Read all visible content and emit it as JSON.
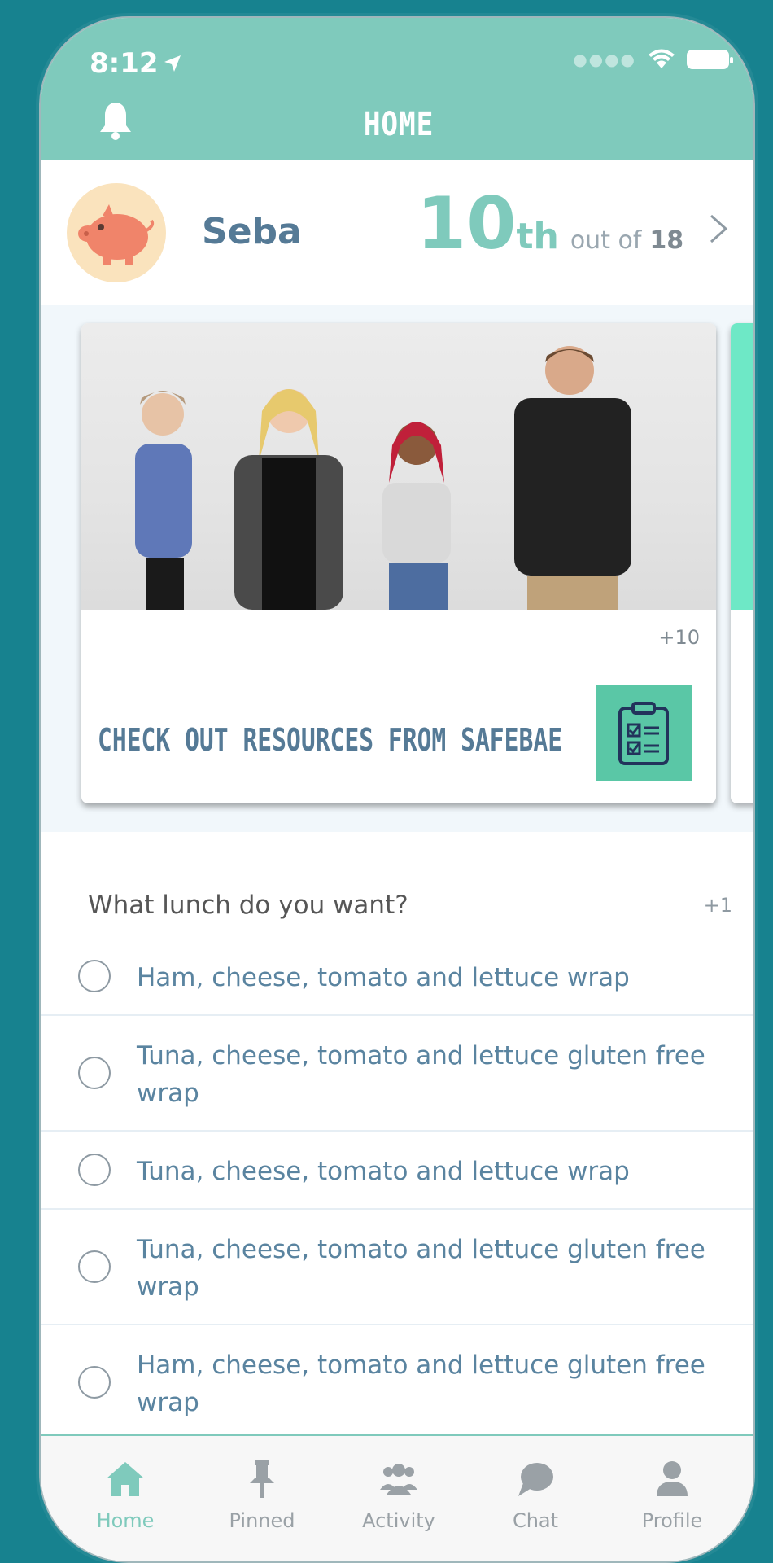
{
  "status_bar": {
    "time": "8:12"
  },
  "header": {
    "title": "HOME"
  },
  "profile": {
    "name": "Seba",
    "rank_number": "10",
    "rank_suffix": "th",
    "out_of_label": "out of",
    "total": "18"
  },
  "carousel": {
    "cards": [
      {
        "points": "+10",
        "title": "CHECK OUT RESOURCES FROM SAFEBAE"
      }
    ]
  },
  "poll": {
    "question": "What lunch do you want?",
    "points": "+1",
    "options": [
      "Ham, cheese, tomato and lettuce wrap",
      "Tuna, cheese, tomato and lettuce gluten free wrap",
      "Tuna, cheese, tomato and lettuce wrap",
      "Tuna, cheese, tomato and lettuce gluten free wrap",
      "Ham, cheese, tomato and lettuce gluten free wrap"
    ]
  },
  "tabbar": {
    "items": [
      {
        "label": "Home",
        "icon": "home-icon",
        "active": true
      },
      {
        "label": "Pinned",
        "icon": "pin-icon",
        "active": false
      },
      {
        "label": "Activity",
        "icon": "group-icon",
        "active": false
      },
      {
        "label": "Chat",
        "icon": "chat-bubble-icon",
        "active": false
      },
      {
        "label": "Profile",
        "icon": "person-icon",
        "active": false
      }
    ]
  },
  "colors": {
    "app_background": "#17828f",
    "header": "#7fcabc",
    "accent_text": "#557a96",
    "option_text": "#5a84a0",
    "badge": "#5ac7a6"
  }
}
